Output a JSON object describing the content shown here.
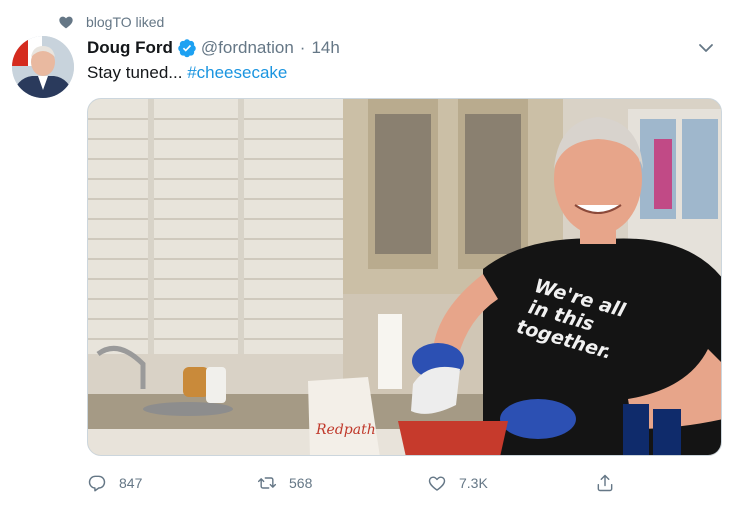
{
  "context": {
    "text": "blogTO liked",
    "icon": "heart-icon"
  },
  "author": {
    "name": "Doug Ford",
    "handle": "@fordnation",
    "dot": "·",
    "time": "14h",
    "verified_color": "#1da1f2"
  },
  "tweet": {
    "text": "Stay tuned... ",
    "hashtag": "#cheesecake"
  },
  "media": {
    "shirt_text": [
      "We're all",
      "in this",
      "together."
    ],
    "bag_text": "Redpath"
  },
  "actions": {
    "replies": "847",
    "retweets": "568",
    "likes": "7.3K"
  },
  "colors": {
    "accent": "#1b95e0",
    "muted": "#657786",
    "border": "#ccd6dd"
  }
}
